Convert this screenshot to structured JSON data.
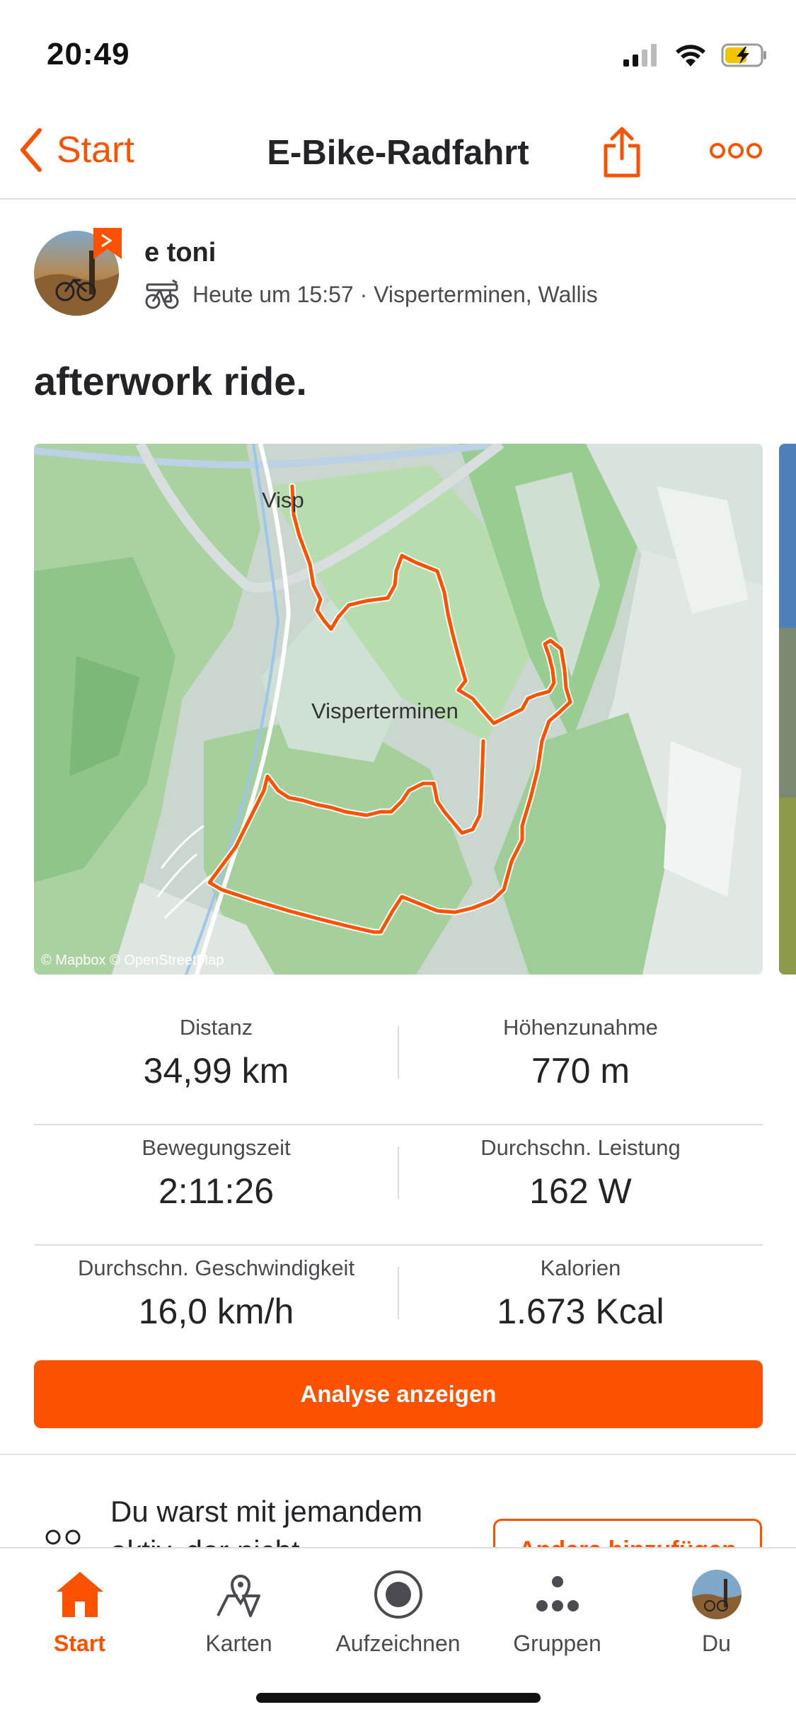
{
  "status_bar": {
    "time": "20:49"
  },
  "nav": {
    "back_label": "Start",
    "title": "E-Bike-Radfahrt"
  },
  "author": {
    "name": "e toni",
    "meta": "Heute um 15:57 · Visperterminen, Wallis"
  },
  "activity": {
    "title": "afterwork ride."
  },
  "map": {
    "label_town": "Visp",
    "label_village": "Visperterminen",
    "credit": "© Mapbox © OpenStreetMap"
  },
  "stats": [
    {
      "left": {
        "label": "Distanz",
        "value": "34,99 km"
      },
      "right": {
        "label": "Höhenzunahme",
        "value": "770 m"
      }
    },
    {
      "left": {
        "label": "Bewegungszeit",
        "value": "2:11:26"
      },
      "right": {
        "label": "Durchschn. Leistung",
        "value": "162 W"
      }
    },
    {
      "left": {
        "label": "Durchschn. Geschwindigkeit",
        "value": "16,0 km/h"
      },
      "right": {
        "label": "Kalorien",
        "value": "1.673 Kcal"
      }
    }
  ],
  "analysis_button": "Analyse anzeigen",
  "together": {
    "text": "Du warst mit jemandem aktiv, der nicht",
    "button": "Andere hinzufügen"
  },
  "tabs": [
    {
      "label": "Start",
      "icon": "home-icon"
    },
    {
      "label": "Karten",
      "icon": "map-pin-icon"
    },
    {
      "label": "Aufzeichnen",
      "icon": "record-icon"
    },
    {
      "label": "Gruppen",
      "icon": "groups-icon"
    },
    {
      "label": "Du",
      "icon": "profile-avatar"
    }
  ],
  "colors": {
    "accent": "#fc5200",
    "text": "#242428",
    "map_green": "#a9d7a0"
  }
}
